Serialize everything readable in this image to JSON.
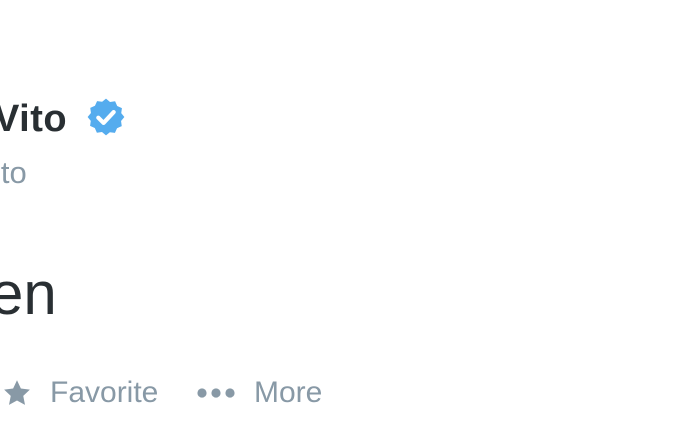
{
  "tweet": {
    "display_name": "Vito",
    "verified": true,
    "screen_name": "ito",
    "text": "en"
  },
  "actions": {
    "favorite_label": "Favorite",
    "favorite_icon": "star-icon",
    "more_label": "More",
    "more_icon": "ellipsis-icon"
  },
  "colors": {
    "name": "#292f33",
    "secondary": "#8899a6",
    "verified": "#55acee"
  }
}
